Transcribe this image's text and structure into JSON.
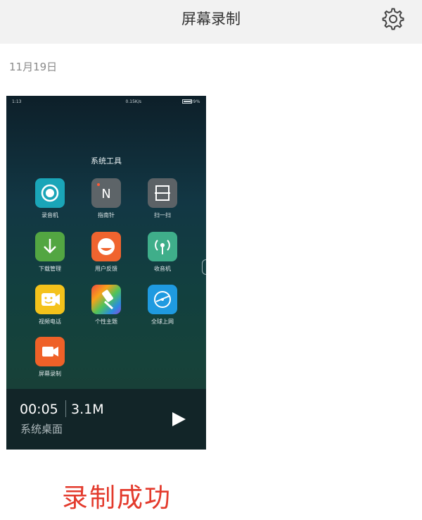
{
  "header": {
    "title": "屏幕录制",
    "settings_icon": "gear-icon"
  },
  "date_label": "11月19日",
  "recording": {
    "thumbnail": {
      "status_bar": {
        "time": "1:13",
        "network": "0.15K/s",
        "battery": "89%"
      },
      "folder_title": "系统工具",
      "apps": [
        {
          "label": "录音机",
          "icon": "recorder-icon",
          "color": "#1aa5b8"
        },
        {
          "label": "指南针",
          "icon": "compass-icon",
          "color": "#5d6468"
        },
        {
          "label": "扫一扫",
          "icon": "scan-icon",
          "color": "#5c6266"
        },
        {
          "label": "下载管理",
          "icon": "download-icon",
          "color": "#53a642"
        },
        {
          "label": "用户反馈",
          "icon": "feedback-icon",
          "color": "#f0642f"
        },
        {
          "label": "收音机",
          "icon": "radio-icon",
          "color": "#3fae8a"
        },
        {
          "label": "视频电话",
          "icon": "video-call-icon",
          "color": "#f4c21b"
        },
        {
          "label": "个性主题",
          "icon": "theme-icon",
          "color": "#7a5bd6"
        },
        {
          "label": "全球上网",
          "icon": "global-net-icon",
          "color": "#1f9ae0"
        },
        {
          "label": "屏幕录制",
          "icon": "screen-record-icon",
          "color": "#ef6128"
        }
      ]
    },
    "duration": "00:05",
    "size": "3.1M",
    "source": "系统桌面",
    "play_icon": "play-icon"
  },
  "status_message": "录制成功",
  "colors": {
    "header_bg": "#f2f2f2",
    "status_message": "#e33a2c"
  }
}
